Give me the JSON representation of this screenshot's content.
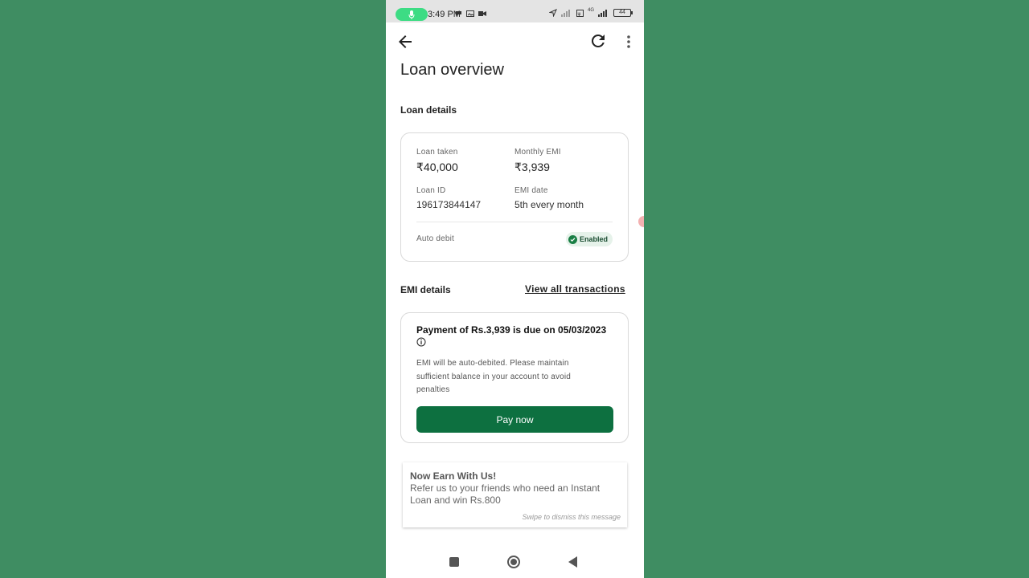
{
  "status_bar": {
    "time": "3:49 PM",
    "battery": "44",
    "network": "4G"
  },
  "header": {
    "back_icon": "arrow-left-icon",
    "refresh_icon": "refresh-icon",
    "more_icon": "more-vertical-icon"
  },
  "page": {
    "title": "Loan overview"
  },
  "loan_details": {
    "section_title": "Loan details",
    "loan_taken_label": "Loan taken",
    "loan_taken_value": "₹40,000",
    "monthly_emi_label": "Monthly EMI",
    "monthly_emi_value": "₹3,939",
    "loan_id_label": "Loan ID",
    "loan_id_value": "196173844147",
    "emi_date_label": "EMI date",
    "emi_date_value": "5th every month",
    "auto_debit_label": "Auto debit",
    "auto_debit_status": "Enabled"
  },
  "emi_details": {
    "section_title": "EMI details",
    "view_all_link": "View all transactions",
    "due_title": "Payment of Rs.3,939 is due on 05/03/2023",
    "description": "EMI will be auto-debited. Please maintain sufficient balance in your account to avoid penalties",
    "pay_button": "Pay now"
  },
  "promo": {
    "title": "Now Earn With Us!",
    "text": "Refer us to your friends who need an Instant Loan and win Rs.800",
    "dismiss_hint": "Swipe to dismiss this message"
  },
  "colors": {
    "background": "#3f8d62",
    "primary_button": "#0d7040",
    "badge_bg": "#e6f2ea"
  }
}
